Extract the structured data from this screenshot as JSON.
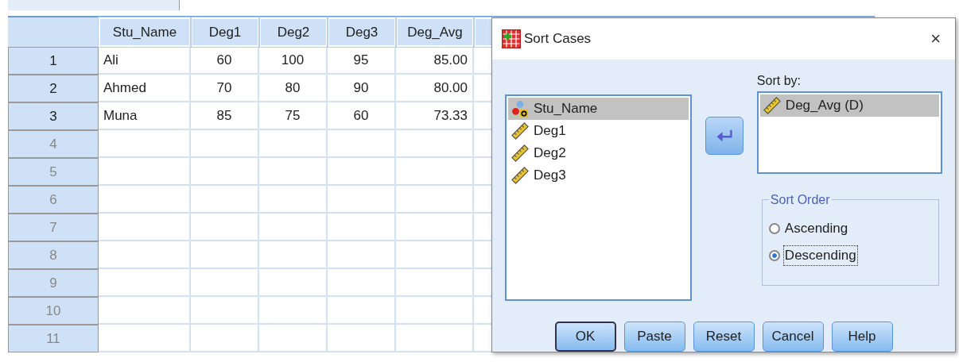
{
  "sheet": {
    "columns": [
      "Stu_Name",
      "Deg1",
      "Deg2",
      "Deg3",
      "Deg_Avg"
    ],
    "rows": [
      {
        "number": "1",
        "cells": [
          "Ali",
          "60",
          "100",
          "95",
          "85.00"
        ]
      },
      {
        "number": "2",
        "cells": [
          "Ahmed",
          "70",
          "80",
          "90",
          "80.00"
        ]
      },
      {
        "number": "3",
        "cells": [
          "Muna",
          "85",
          "75",
          "60",
          "73.33"
        ]
      },
      {
        "number": "4",
        "cells": []
      },
      {
        "number": "5",
        "cells": []
      },
      {
        "number": "6",
        "cells": []
      },
      {
        "number": "7",
        "cells": []
      },
      {
        "number": "8",
        "cells": []
      },
      {
        "number": "9",
        "cells": []
      },
      {
        "number": "10",
        "cells": []
      },
      {
        "number": "11",
        "cells": []
      }
    ]
  },
  "dialog": {
    "title": "Sort Cases",
    "close": "×",
    "variables": [
      {
        "label": "Stu_Name",
        "kind": "nominal",
        "selected": true
      },
      {
        "label": "Deg1",
        "kind": "scale",
        "selected": false
      },
      {
        "label": "Deg2",
        "kind": "scale",
        "selected": false
      },
      {
        "label": "Deg3",
        "kind": "scale",
        "selected": false
      }
    ],
    "sort_by_label": "Sort by:",
    "sort_by": [
      {
        "label": "Deg_Avg (D)",
        "kind": "scale",
        "selected": true
      }
    ],
    "sort_order": {
      "legend": "Sort Order",
      "options": [
        {
          "label": "Ascending",
          "selected": false,
          "focused": false
        },
        {
          "label": "Descending",
          "selected": true,
          "focused": true
        }
      ]
    },
    "buttons": [
      {
        "label": "OK",
        "default": true
      },
      {
        "label": "Paste",
        "default": false
      },
      {
        "label": "Reset",
        "default": false
      },
      {
        "label": "Cancel",
        "default": false
      },
      {
        "label": "Help",
        "default": false
      }
    ]
  }
}
